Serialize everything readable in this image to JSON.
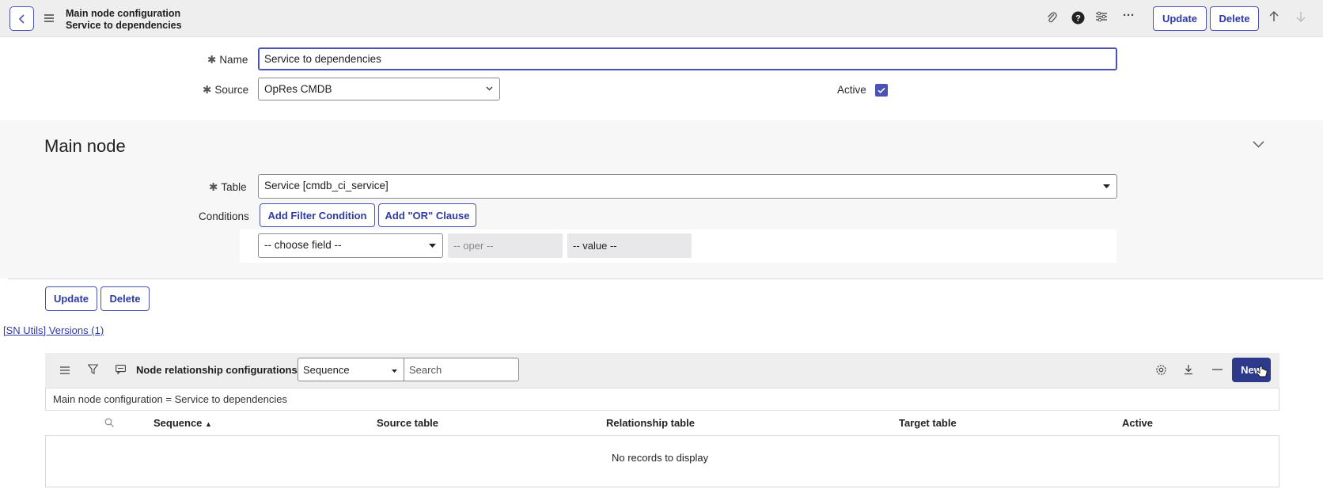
{
  "header": {
    "title_line1": "Main node configuration",
    "title_line2": "Service to dependencies",
    "update_label": "Update",
    "delete_label": "Delete"
  },
  "form": {
    "name_label": "Name",
    "name_value": "Service to dependencies",
    "source_label": "Source",
    "source_value": "OpRes CMDB",
    "active_label": "Active",
    "active_checked": true
  },
  "section": {
    "title": "Main node",
    "table_label": "Table",
    "table_value": "Service [cmdb_ci_service]",
    "conditions_label": "Conditions",
    "add_filter_label": "Add Filter Condition",
    "add_or_label": "Add \"OR\" Clause",
    "choose_field": "-- choose field --",
    "oper": "-- oper --",
    "value": "-- value --"
  },
  "actions": {
    "update_label": "Update",
    "delete_label": "Delete",
    "versions_link": "[SN Utils] Versions (1)"
  },
  "related_list": {
    "title": "Node relationship configurations",
    "search_field": "Sequence",
    "search_placeholder": "Search",
    "new_label": "New",
    "filter_breadcrumb": "Main node configuration = Service to dependencies",
    "columns": [
      "Sequence",
      "Source table",
      "Relationship table",
      "Target table",
      "Active"
    ],
    "empty_message": "No records to display"
  },
  "colors": {
    "accent": "#4a53b5",
    "primary_button": "#2d3a8c"
  }
}
